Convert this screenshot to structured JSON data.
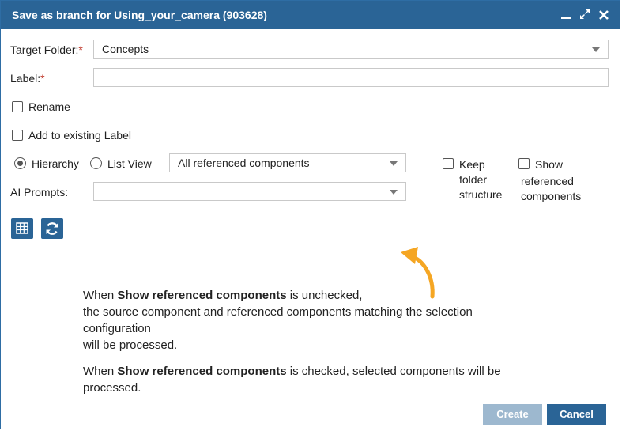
{
  "dialog": {
    "title": "Save as branch for Using_your_camera (903628)"
  },
  "form": {
    "target_folder_label": "Target Folder:",
    "target_folder_value": "Concepts",
    "required_mark": "*",
    "label_label": "Label:",
    "label_value": "",
    "rename_label": "Rename",
    "add_existing_label": "Add to existing Label",
    "hierarchy_label": "Hierarchy",
    "list_view_label": "List View",
    "filter_value": "All referenced components",
    "ai_prompts_label": "AI Prompts:",
    "ai_prompts_value": "",
    "keep_folder_line1": "Keep",
    "keep_folder_line2": "folder",
    "keep_folder_line3": "structure",
    "show_ref_line1": "Show",
    "show_ref_line2": "referenced",
    "show_ref_line3": "components"
  },
  "note": {
    "p1_prefix": "When ",
    "p1_bold": "Show referenced components",
    "p1_suffix": " is unchecked,",
    "p1_line2": "the source component and referenced components matching the selection",
    "p1_line3": "configuration",
    "p1_line4": "will be processed.",
    "p2_prefix": "When ",
    "p2_bold": "Show referenced components",
    "p2_suffix": " is checked, selected components will be",
    "p2_line2": "processed."
  },
  "buttons": {
    "create": "Create",
    "cancel": "Cancel"
  },
  "colors": {
    "titlebar": "#2a6496",
    "arrow": "#f5a623",
    "create_disabled": "#9db8cf"
  }
}
